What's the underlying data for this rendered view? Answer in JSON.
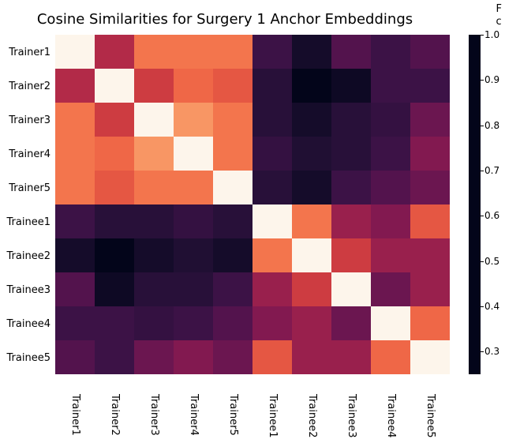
{
  "title": "Cosine Similarities for Surgery 1 Anchor Embeddings",
  "right_fragment_1": "F",
  "right_fragment_2": "c",
  "chart_data": {
    "type": "heatmap",
    "title": "Cosine Similarities for Surgery 1 Anchor Embeddings",
    "x_labels": [
      "Trainer1",
      "Trainer2",
      "Trainer3",
      "Trainer4",
      "Trainer5",
      "Trainee1",
      "Trainee2",
      "Trainee3",
      "Trainee4",
      "Trainee5"
    ],
    "y_labels": [
      "Trainer1",
      "Trainer2",
      "Trainer3",
      "Trainer4",
      "Trainer5",
      "Trainee1",
      "Trainee2",
      "Trainee3",
      "Trainee4",
      "Trainee5"
    ],
    "matrix": [
      [
        1.0,
        0.65,
        0.8,
        0.8,
        0.8,
        0.4,
        0.3,
        0.45,
        0.4,
        0.45
      ],
      [
        0.65,
        1.0,
        0.7,
        0.78,
        0.75,
        0.35,
        0.25,
        0.28,
        0.4,
        0.4
      ],
      [
        0.8,
        0.7,
        1.0,
        0.85,
        0.8,
        0.35,
        0.3,
        0.35,
        0.38,
        0.5
      ],
      [
        0.8,
        0.78,
        0.85,
        1.0,
        0.8,
        0.38,
        0.33,
        0.35,
        0.4,
        0.55
      ],
      [
        0.8,
        0.75,
        0.8,
        0.8,
        1.0,
        0.35,
        0.3,
        0.4,
        0.45,
        0.5
      ],
      [
        0.4,
        0.35,
        0.35,
        0.38,
        0.35,
        1.0,
        0.8,
        0.6,
        0.55,
        0.75
      ],
      [
        0.3,
        0.25,
        0.3,
        0.33,
        0.3,
        0.8,
        1.0,
        0.7,
        0.6,
        0.6
      ],
      [
        0.45,
        0.28,
        0.35,
        0.35,
        0.4,
        0.6,
        0.7,
        1.0,
        0.5,
        0.6
      ],
      [
        0.4,
        0.4,
        0.38,
        0.4,
        0.45,
        0.55,
        0.6,
        0.5,
        1.0,
        0.78
      ],
      [
        0.45,
        0.4,
        0.5,
        0.55,
        0.5,
        0.75,
        0.6,
        0.6,
        0.78,
        1.0
      ]
    ],
    "colorbar": {
      "ticks": [
        0.3,
        0.4,
        0.5,
        0.6,
        0.7,
        0.8,
        0.9,
        1.0
      ],
      "range": [
        0.25,
        1.0
      ]
    }
  }
}
